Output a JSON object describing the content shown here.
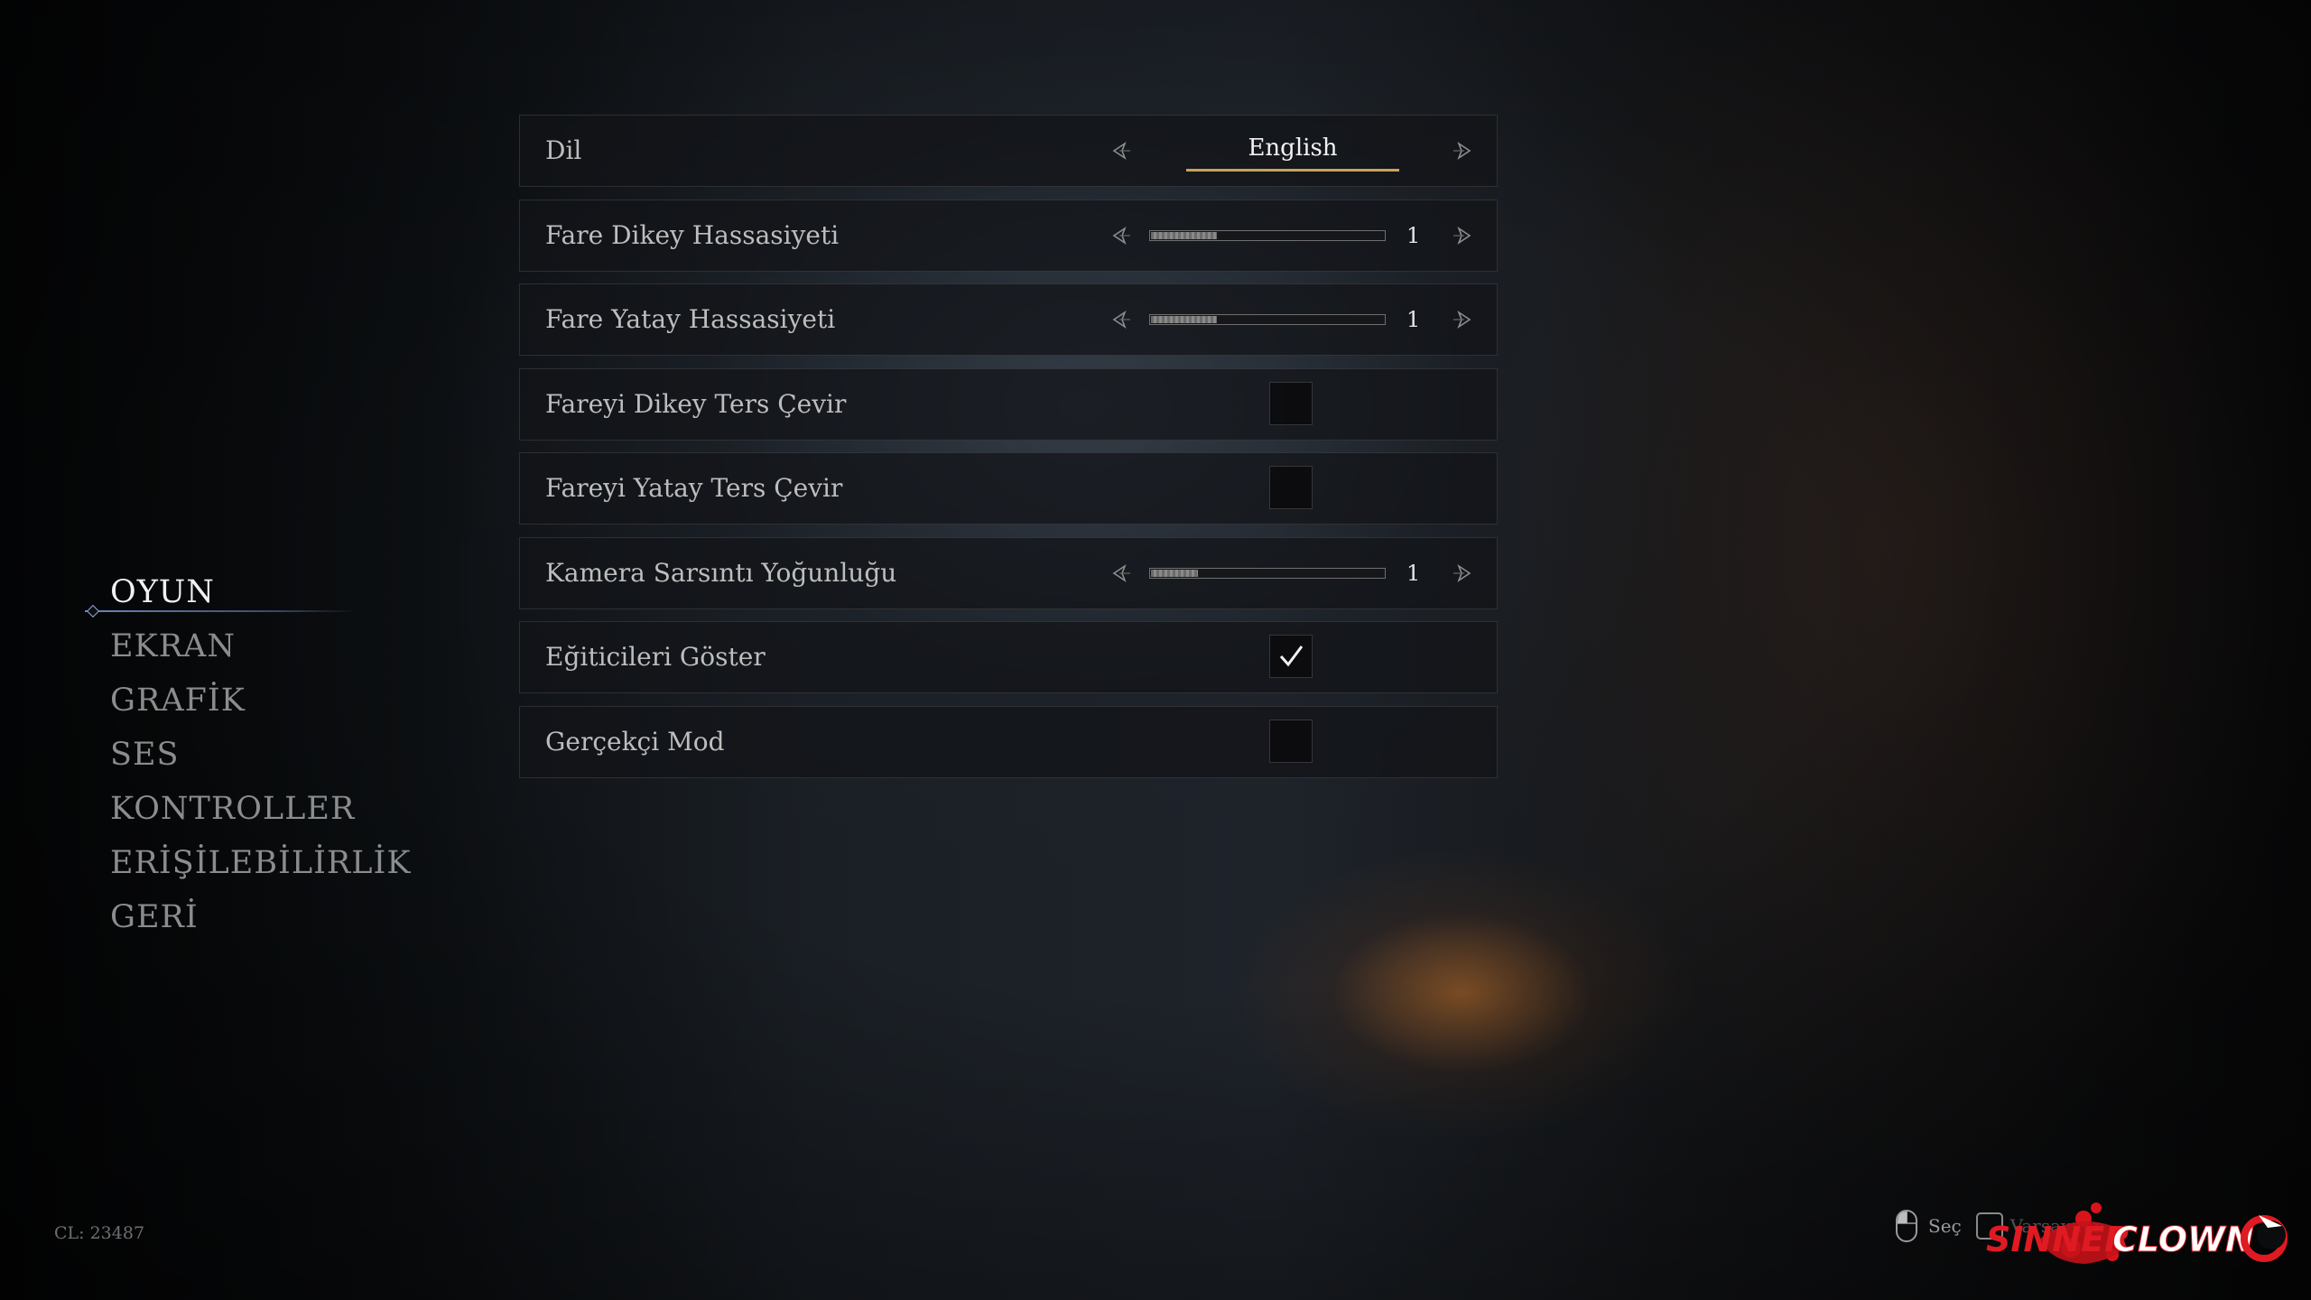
{
  "side_menu": {
    "items": [
      {
        "label": "OYUN",
        "active": true
      },
      {
        "label": "EKRAN",
        "active": false
      },
      {
        "label": "GRAFİK",
        "active": false
      },
      {
        "label": "SES",
        "active": false
      },
      {
        "label": "KONTROLLER",
        "active": false
      },
      {
        "label": "ERİŞİLEBİLİRLİK",
        "active": false
      },
      {
        "label": "GERİ",
        "active": false
      }
    ]
  },
  "settings": {
    "language": {
      "label": "Dil",
      "value": "English"
    },
    "mouse_vertical_sensitivity": {
      "label": "Fare Dikey Hassasiyeti",
      "value": "1",
      "fill": 0.28
    },
    "mouse_horizontal_sensitivity": {
      "label": "Fare Yatay Hassasiyeti",
      "value": "1",
      "fill": 0.28
    },
    "invert_vertical": {
      "label": "Fareyi Dikey Ters Çevir",
      "checked": false
    },
    "invert_horizontal": {
      "label": "Fareyi Yatay Ters Çevir",
      "checked": false
    },
    "camera_shake": {
      "label": "Kamera Sarsıntı Yoğunluğu",
      "value": "1",
      "fill": 0.2
    },
    "show_tutorials": {
      "label": "Eğiticileri Göster",
      "checked": true
    },
    "realistic_mode": {
      "label": "Gerçekçi Mod",
      "checked": false
    }
  },
  "footer": {
    "build_label": "CL: 23487",
    "hint_select": "Seç",
    "hint_default": "Varsayılan",
    "watermark_left": "SINNER",
    "watermark_right": "CLOWN"
  },
  "colors": {
    "accent_underline": "#c8a35a",
    "menu_active": "#f1f1f1",
    "menu_inactive": "#8a8c8e",
    "watermark_red": "#d8141b"
  },
  "icons": {
    "arrow_left": "arrow-left-icon",
    "arrow_right": "arrow-right-icon",
    "checkmark": "checkmark-icon",
    "mouse": "mouse-icon",
    "key": "keyboard-key-icon"
  }
}
